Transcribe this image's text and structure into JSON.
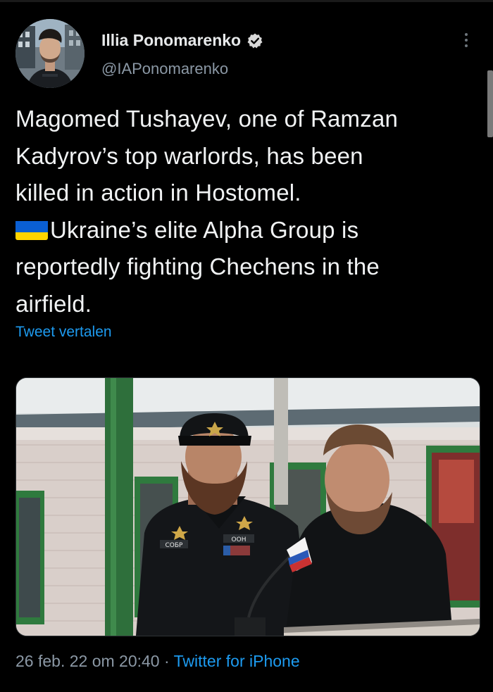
{
  "tweet": {
    "author": {
      "display_name": "Illia Ponomarenko",
      "handle": "@IAPonomarenko",
      "verified": true
    },
    "text_lines": [
      "Magomed Tushayev, one of Ramzan",
      "Kadyrov’s top warlords, has been",
      "killed in action in Hostomel.",
      "Ukraine’s elite Alpha Group is",
      "reportedly fighting Chechens in the",
      "airfield."
    ],
    "flag_emoji_icon": "ukraine-flag-icon",
    "translate_label": "Tweet vertalen",
    "timestamp": "26 feb. 22 om 20:40",
    "separator": " · ",
    "source": "Twitter for iPhone",
    "photo_badges": {
      "left_chest": "СОБР",
      "right_chest": "ООН"
    }
  },
  "colors": {
    "background": "#000000",
    "text": "#e7e9ea",
    "secondary": "#8b98a5",
    "link": "#1d9bf0",
    "verified": "#d9d9d9",
    "flag_blue": "#0a5fd3",
    "flag_yellow": "#ffd400"
  }
}
